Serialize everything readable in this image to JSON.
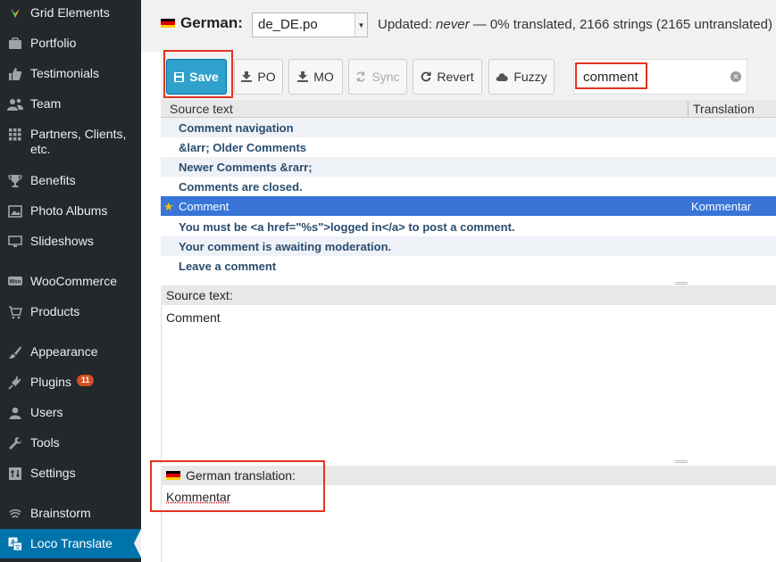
{
  "sidebar": {
    "items": [
      {
        "label": "Grid Elements",
        "icon": "grid-elements-icon"
      },
      {
        "label": "Portfolio",
        "icon": "portfolio-icon"
      },
      {
        "label": "Testimonials",
        "icon": "thumbs-up-icon"
      },
      {
        "label": "Team",
        "icon": "team-icon"
      },
      {
        "label": "Partners, Clients, etc.",
        "icon": "partners-grid-icon"
      },
      {
        "label": "Benefits",
        "icon": "trophy-icon"
      },
      {
        "label": "Photo Albums",
        "icon": "photo-icon"
      },
      {
        "label": "Slideshows",
        "icon": "slideshow-icon"
      },
      {
        "label": "WooCommerce",
        "icon": "woocommerce-icon"
      },
      {
        "label": "Products",
        "icon": "products-icon"
      },
      {
        "label": "Appearance",
        "icon": "appearance-icon"
      },
      {
        "label": "Plugins",
        "icon": "plugins-icon",
        "badge": "11"
      },
      {
        "label": "Users",
        "icon": "users-icon"
      },
      {
        "label": "Tools",
        "icon": "tools-icon"
      },
      {
        "label": "Settings",
        "icon": "settings-icon"
      },
      {
        "label": "Brainstorm",
        "icon": "brainstorm-icon"
      },
      {
        "label": "Loco Translate",
        "icon": "loco-translate-icon",
        "active": true
      }
    ]
  },
  "header": {
    "language": "German:",
    "po_file": "de_DE.po",
    "status_prefix": "Updated: ",
    "status_never": "never",
    "status_suffix": " — 0% translated, 2166 strings (2165 untranslated)"
  },
  "toolbar": {
    "save": "Save",
    "po": "PO",
    "mo": "MO",
    "sync": "Sync",
    "revert": "Revert",
    "fuzzy": "Fuzzy",
    "search_value": "comment"
  },
  "grid": {
    "col_source": "Source text",
    "col_translation": "Translation",
    "rows": [
      {
        "source": "Comment navigation",
        "translation": ""
      },
      {
        "source": "&larr; Older Comments",
        "translation": ""
      },
      {
        "source": "Newer Comments &rarr;",
        "translation": ""
      },
      {
        "source": "Comments are closed.",
        "translation": ""
      },
      {
        "source": "Comment",
        "translation": "Kommentar",
        "selected": true
      },
      {
        "source": "You must be <a href=\"%s\">logged in</a> to post a comment.",
        "translation": ""
      },
      {
        "source": "Your comment is awaiting moderation.",
        "translation": ""
      },
      {
        "source": "Leave a comment",
        "translation": ""
      }
    ]
  },
  "source_pane": {
    "heading": "Source text:",
    "text": "Comment"
  },
  "translation_pane": {
    "heading": "German translation:",
    "text": "Kommentar"
  },
  "colors": {
    "sidebar_bg": "#23282d",
    "active_blue": "#0073aa",
    "save_blue": "#2ea2cc",
    "highlight_red": "#e3331f",
    "selected_row": "#3875d7"
  }
}
